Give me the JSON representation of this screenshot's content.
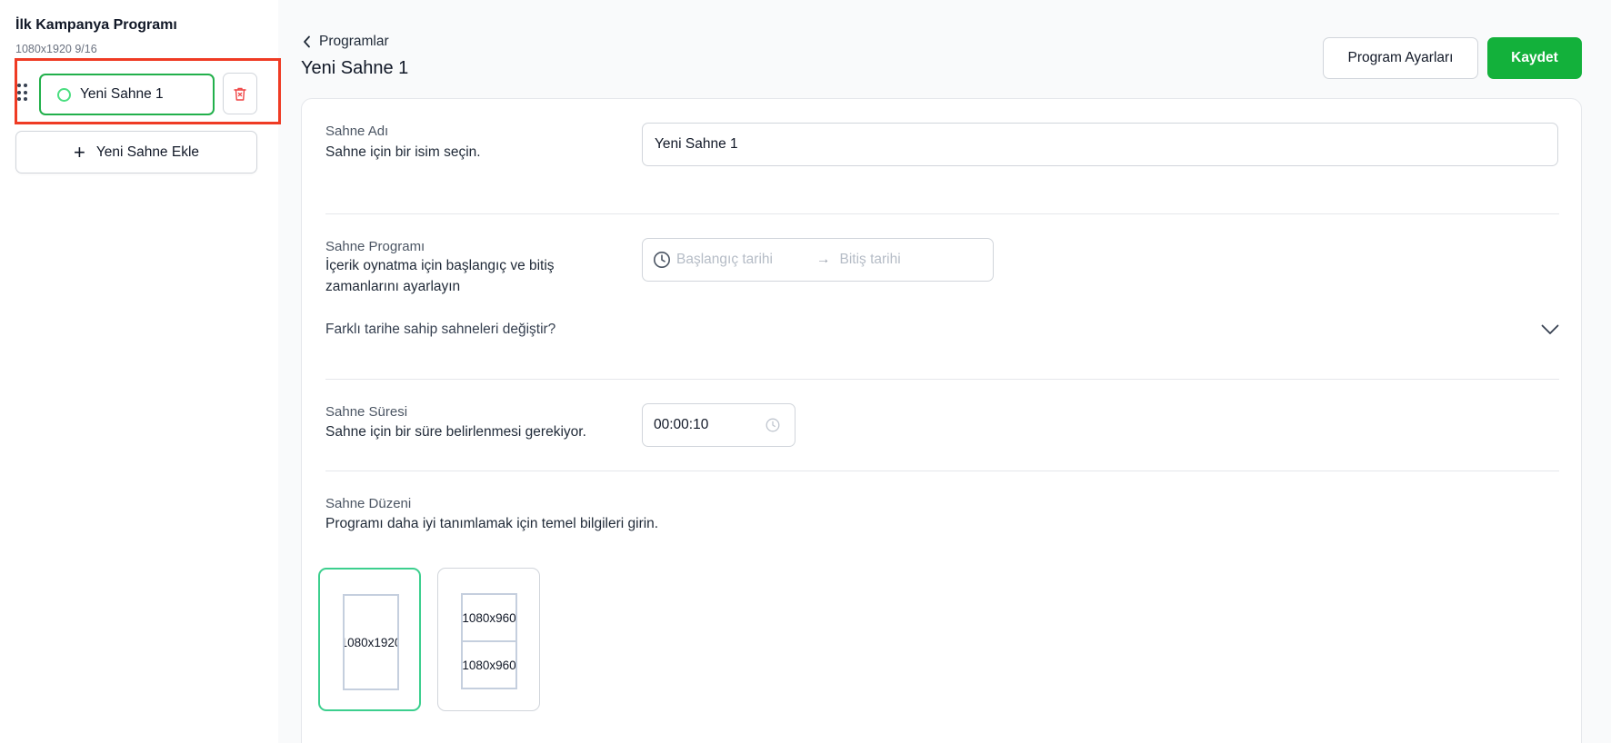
{
  "sidebar": {
    "title": "İlk Kampanya Programı",
    "subtitle": "1080x1920 9/16",
    "scenes": [
      {
        "label": "Yeni Sahne 1"
      }
    ],
    "add_scene_label": "Yeni Sahne Ekle"
  },
  "header": {
    "back_label": "Programlar",
    "title": "Yeni Sahne 1",
    "settings_label": "Program Ayarları",
    "save_label": "Kaydet"
  },
  "form": {
    "scene_name": {
      "label": "Sahne Adı",
      "description": "Sahne için bir isim seçin.",
      "value": "Yeni Sahne 1"
    },
    "scene_schedule": {
      "label": "Sahne Programı",
      "description_line1": "İçerik oynatma için başlangıç ve bitiş",
      "description_line2": "zamanlarını ayarlayın",
      "start_placeholder": "Başlangıç tarihi",
      "end_placeholder": "Bitiş tarihi",
      "toggle_label": "Farklı tarihe sahip sahneleri değiştir?"
    },
    "scene_duration": {
      "label": "Sahne Süresi",
      "description": "Sahne için bir süre belirlenmesi gerekiyor.",
      "value": "00:00:10"
    },
    "scene_layout": {
      "label": "Sahne Düzeni",
      "description": "Programı daha iyi tanımlamak için temel bilgileri girin.",
      "options": [
        {
          "parts": [
            "1080x1920"
          ],
          "selected": true
        },
        {
          "parts": [
            "1080x960",
            "1080x960"
          ],
          "selected": false
        }
      ]
    }
  },
  "colors": {
    "accent_green": "#13b13b",
    "selected_border": "#22b04b",
    "highlight_red": "#ef3b24",
    "delete_red": "#ef4444"
  },
  "icons": {
    "drag": "drag-handle-icon",
    "status": "circle-icon",
    "delete": "trash-icon",
    "add": "plus-icon",
    "back": "chevron-left-icon",
    "date": "clock-icon",
    "expand": "chevron-down-icon",
    "duration": "clock-icon"
  }
}
